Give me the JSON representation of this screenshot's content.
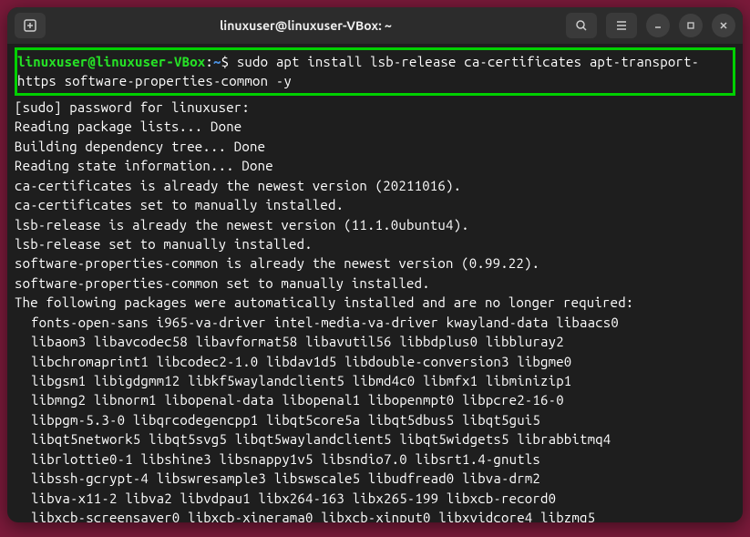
{
  "titlebar": {
    "title": "linuxuser@linuxuser-VBox: ~"
  },
  "prompt": {
    "user_host": "linuxuser@linuxuser-VBox",
    "path": "~",
    "command": "sudo apt install lsb-release ca-certificates apt-transport-https software-properties-common -y"
  },
  "output": {
    "l1": "[sudo] password for linuxuser:",
    "l2": "Reading package lists... Done",
    "l3": "Building dependency tree... Done",
    "l4": "Reading state information... Done",
    "l5": "ca-certificates is already the newest version (20211016).",
    "l6": "ca-certificates set to manually installed.",
    "l7": "lsb-release is already the newest version (11.1.0ubuntu4).",
    "l8": "lsb-release set to manually installed.",
    "l9": "software-properties-common is already the newest version (0.99.22).",
    "l10": "software-properties-common set to manually installed.",
    "l11": "The following packages were automatically installed and are no longer required:",
    "p1": "fonts-open-sans i965-va-driver intel-media-va-driver kwayland-data libaacs0",
    "p2": "libaom3 libavcodec58 libavformat58 libavutil56 libbdplus0 libbluray2",
    "p3": "libchromaprint1 libcodec2-1.0 libdav1d5 libdouble-conversion3 libgme0",
    "p4": "libgsm1 libigdgmm12 libkf5waylandclient5 libmd4c0 libmfx1 libminizip1",
    "p5": "libmng2 libnorm1 libopenal-data libopenal1 libopenmpt0 libpcre2-16-0",
    "p6": "libpgm-5.3-0 libqrcodegencpp1 libqt5core5a libqt5dbus5 libqt5gui5",
    "p7": "libqt5network5 libqt5svg5 libqt5waylandclient5 libqt5widgets5 librabbitmq4",
    "p8": "librlottie0-1 libshine3 libsnappy1v5 libsndio7.0 libsrt1.4-gnutls",
    "p9": "libssh-gcrypt-4 libswresample3 libswscale5 libudfread0 libva-drm2",
    "p10": "libva-x11-2 libva2 libvdpau1 libx264-163 libx265-199 libxcb-record0",
    "p11": "libxcb-screensaver0 libxcb-xinerama0 libxcb-xinput0 libxvidcore4 libzmq5"
  }
}
